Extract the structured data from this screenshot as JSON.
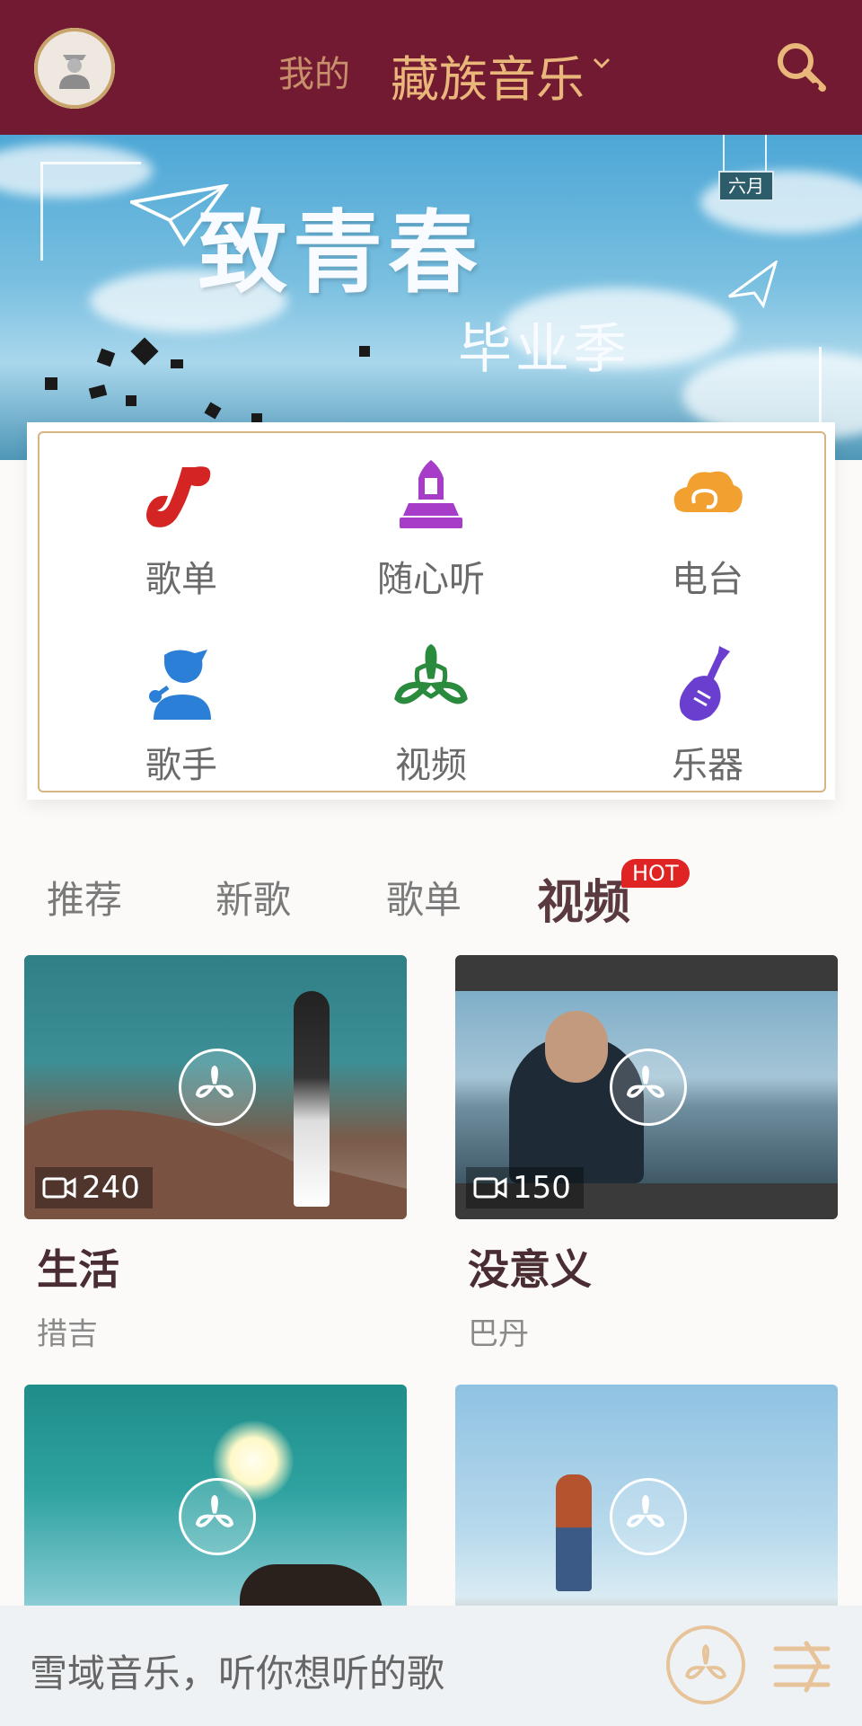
{
  "header": {
    "mine_label": "我的",
    "current_channel": "藏族音乐",
    "accent_color": "#731a33"
  },
  "banner": {
    "title": "致青春",
    "subtitle": "毕业季",
    "month_tag": "六月"
  },
  "categories": [
    {
      "label": "歌单",
      "icon": "song-list-icon",
      "color": "#d42424"
    },
    {
      "label": "随心听",
      "icon": "stupa-icon",
      "color": "#a63cc8"
    },
    {
      "label": "电台",
      "icon": "cloud-icon",
      "color": "#f2a130"
    },
    {
      "label": "歌手",
      "icon": "singer-icon",
      "color": "#2c7fd6"
    },
    {
      "label": "视频",
      "icon": "knot-icon",
      "color": "#2a8a3d"
    },
    {
      "label": "乐器",
      "icon": "lute-icon",
      "color": "#6a3fd0"
    }
  ],
  "tabs": [
    {
      "label": "推荐"
    },
    {
      "label": "新歌"
    },
    {
      "label": "歌单"
    },
    {
      "label": "视频",
      "active": true,
      "badge": "HOT"
    }
  ],
  "videos": [
    {
      "title": "生活",
      "artist": "措吉",
      "count": "240"
    },
    {
      "title": "没意义",
      "artist": "巴丹",
      "count": "150"
    },
    {
      "title": "",
      "artist": "",
      "count": ""
    },
    {
      "title": "",
      "artist": "",
      "count": ""
    }
  ],
  "bottom": {
    "slogan": "雪域音乐，听你想听的歌"
  }
}
